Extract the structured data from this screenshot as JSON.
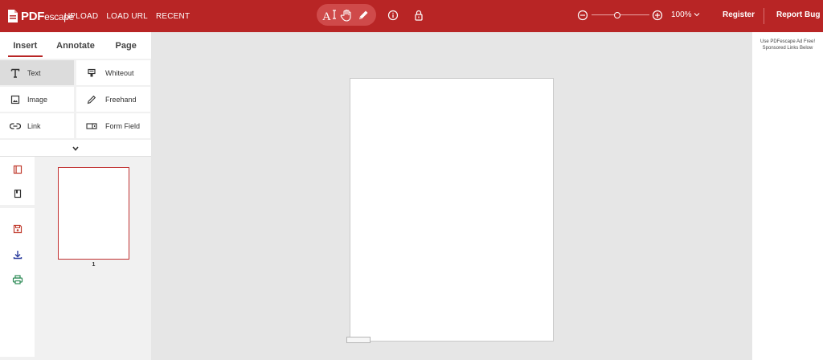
{
  "app": {
    "logo_bold": "PDF",
    "logo_light": "escape"
  },
  "topnav": {
    "upload": "UPLOAD",
    "load_url": "LOAD URL",
    "recent": "RECENT"
  },
  "tools_top": {
    "text_tool": "text-cursor-icon",
    "hand_tool": "hand-icon",
    "pen_tool": "pencil-icon",
    "info": "info-icon",
    "lock": "lock-icon"
  },
  "zoom": {
    "level": "100%",
    "slider_fraction": 0.45
  },
  "top_right": {
    "register": "Register",
    "report_bug": "Report Bug"
  },
  "tabs": [
    "Insert",
    "Annotate",
    "Page"
  ],
  "insert_tools": [
    {
      "label": "Text",
      "icon": "text-icon"
    },
    {
      "label": "Whiteout",
      "icon": "whiteout-icon"
    },
    {
      "label": "Image",
      "icon": "image-icon"
    },
    {
      "label": "Freehand",
      "icon": "pencil-icon"
    },
    {
      "label": "Link",
      "icon": "link-icon"
    },
    {
      "label": "Form Field",
      "icon": "form-field-icon"
    }
  ],
  "thumbnails": {
    "page_number": "1"
  },
  "ad": {
    "line1": "Use PDFescape Ad Free!",
    "line2": "Sponsored Links Below"
  },
  "colors": {
    "brand": "#b82525",
    "save": "#c0392b",
    "download": "#2c3e9e",
    "print": "#2e8b57"
  }
}
